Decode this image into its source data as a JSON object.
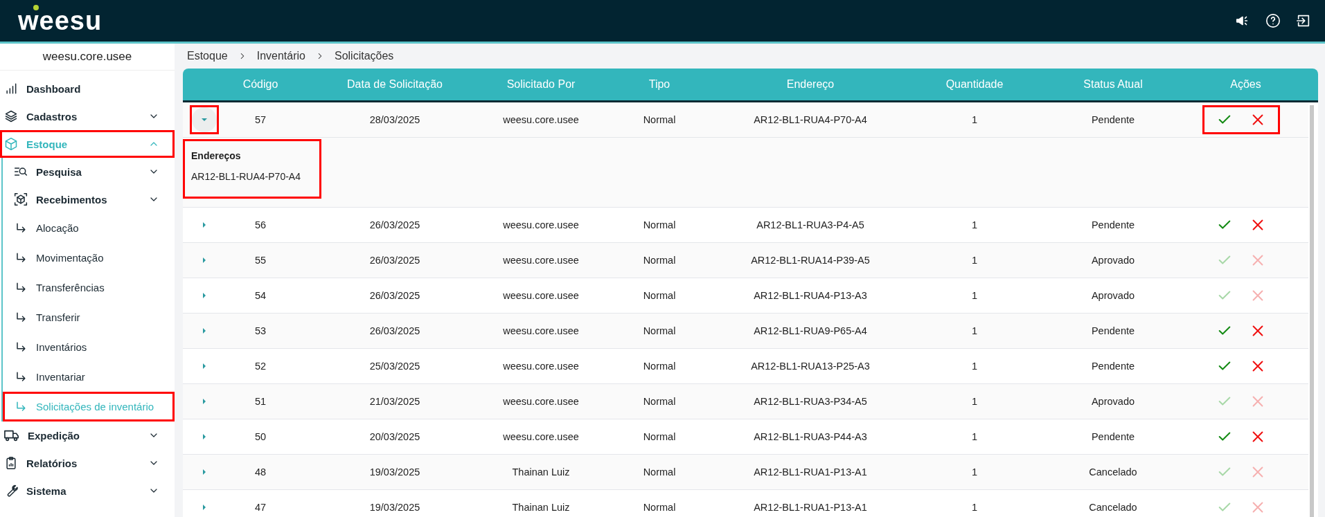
{
  "header": {
    "logo": "weesu"
  },
  "sidebar": {
    "user": "weesu.core.usee",
    "items": [
      {
        "label": "Dashboard",
        "kind": "link",
        "selected": false,
        "highlighted": false
      },
      {
        "label": "Cadastros",
        "kind": "menu",
        "expanded": false,
        "selected": false,
        "highlighted": false
      },
      {
        "label": "Estoque",
        "kind": "menu",
        "expanded": true,
        "selected": true,
        "highlighted": true,
        "children": [
          {
            "label": "Pesquisa",
            "kind": "menu",
            "expanded": false,
            "selected": false,
            "highlighted": false
          },
          {
            "label": "Recebimentos",
            "kind": "menu",
            "expanded": false,
            "selected": false,
            "highlighted": false
          },
          {
            "label": "Alocação",
            "kind": "link",
            "selected": false,
            "highlighted": false
          },
          {
            "label": "Movimentação",
            "kind": "link",
            "selected": false,
            "highlighted": false
          },
          {
            "label": "Transferências",
            "kind": "link",
            "selected": false,
            "highlighted": false
          },
          {
            "label": "Transferir",
            "kind": "link",
            "selected": false,
            "highlighted": false
          },
          {
            "label": "Inventários",
            "kind": "link",
            "selected": false,
            "highlighted": false
          },
          {
            "label": "Inventariar",
            "kind": "link",
            "selected": false,
            "highlighted": false
          },
          {
            "label": "Solicitações de inventário",
            "kind": "link",
            "selected": true,
            "highlighted": true
          }
        ]
      },
      {
        "label": "Expedição",
        "kind": "menu",
        "expanded": false,
        "selected": false,
        "highlighted": false
      },
      {
        "label": "Relatórios",
        "kind": "menu",
        "expanded": false,
        "selected": false,
        "highlighted": false
      },
      {
        "label": "Sistema",
        "kind": "menu",
        "expanded": false,
        "selected": false,
        "highlighted": false
      }
    ]
  },
  "breadcrumbs": [
    "Estoque",
    "Inventário",
    "Solicitações"
  ],
  "table": {
    "columns": [
      "Código",
      "Data de Solicitação",
      "Solicitado Por",
      "Tipo",
      "Endereço",
      "Quantidade",
      "Status Atual",
      "Ações"
    ],
    "rows": [
      {
        "cells": [
          "57",
          "28/03/2025",
          "weesu.core.usee",
          "Normal",
          "AR12-BL1-RUA4-P70-A4",
          "1",
          "Pendente"
        ],
        "expanded": true,
        "highlighted": true,
        "actions_enabled": true,
        "details": {
          "label": "Endereços",
          "value": "AR12-BL1-RUA4-P70-A4",
          "highlighted": true
        }
      },
      {
        "cells": [
          "56",
          "26/03/2025",
          "weesu.core.usee",
          "Normal",
          "AR12-BL1-RUA3-P4-A5",
          "1",
          "Pendente"
        ],
        "expanded": false,
        "highlighted": false,
        "actions_enabled": true
      },
      {
        "cells": [
          "55",
          "26/03/2025",
          "weesu.core.usee",
          "Normal",
          "AR12-BL1-RUA14-P39-A5",
          "1",
          "Aprovado"
        ],
        "expanded": false,
        "highlighted": false,
        "actions_enabled": false
      },
      {
        "cells": [
          "54",
          "26/03/2025",
          "weesu.core.usee",
          "Normal",
          "AR12-BL1-RUA4-P13-A3",
          "1",
          "Aprovado"
        ],
        "expanded": false,
        "highlighted": false,
        "actions_enabled": false
      },
      {
        "cells": [
          "53",
          "26/03/2025",
          "weesu.core.usee",
          "Normal",
          "AR12-BL1-RUA9-P65-A4",
          "1",
          "Pendente"
        ],
        "expanded": false,
        "highlighted": false,
        "actions_enabled": true
      },
      {
        "cells": [
          "52",
          "25/03/2025",
          "weesu.core.usee",
          "Normal",
          "AR12-BL1-RUA13-P25-A3",
          "1",
          "Pendente"
        ],
        "expanded": false,
        "highlighted": false,
        "actions_enabled": true
      },
      {
        "cells": [
          "51",
          "21/03/2025",
          "weesu.core.usee",
          "Normal",
          "AR12-BL1-RUA3-P34-A5",
          "1",
          "Aprovado"
        ],
        "expanded": false,
        "highlighted": false,
        "actions_enabled": false
      },
      {
        "cells": [
          "50",
          "20/03/2025",
          "weesu.core.usee",
          "Normal",
          "AR12-BL1-RUA3-P44-A3",
          "1",
          "Pendente"
        ],
        "expanded": false,
        "highlighted": false,
        "actions_enabled": true
      },
      {
        "cells": [
          "48",
          "19/03/2025",
          "Thainan Luiz",
          "Normal",
          "AR12-BL1-RUA1-P13-A1",
          "1",
          "Cancelado"
        ],
        "expanded": false,
        "highlighted": false,
        "actions_enabled": false
      },
      {
        "cells": [
          "47",
          "19/03/2025",
          "Thainan Luiz",
          "Normal",
          "AR12-BL1-RUA1-P13-A1",
          "1",
          "Cancelado"
        ],
        "expanded": false,
        "highlighted": false,
        "actions_enabled": false
      }
    ]
  }
}
